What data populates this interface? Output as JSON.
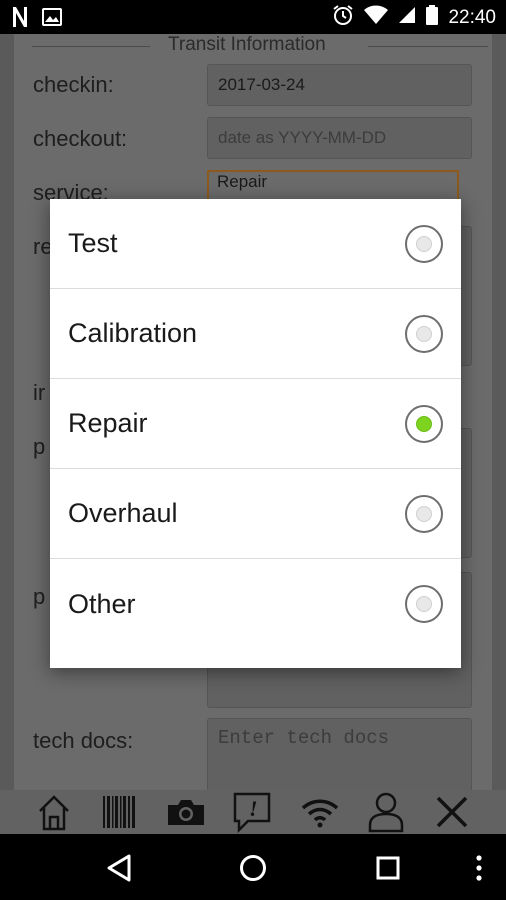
{
  "status_bar": {
    "time": "22:40",
    "icons": [
      "notification-n-icon",
      "image-icon",
      "alarm-icon",
      "wifi-icon",
      "signal-icon",
      "battery-icon"
    ]
  },
  "form": {
    "legend": "Transit Information",
    "checkin_label": "checkin:",
    "checkin_value": "2017-03-24",
    "checkout_label": "checkout:",
    "checkout_placeholder": "date as YYYY-MM-DD",
    "service_label": "service:",
    "service_value": "Repair",
    "partial_labels": [
      "re",
      "ir",
      "p",
      "p"
    ],
    "tech_docs_label": "tech docs:",
    "tech_docs_placeholder": "Enter tech docs"
  },
  "dialog": {
    "options": [
      {
        "label": "Test",
        "selected": false
      },
      {
        "label": "Calibration",
        "selected": false
      },
      {
        "label": "Repair",
        "selected": true
      },
      {
        "label": "Overhaul",
        "selected": false
      },
      {
        "label": "Other",
        "selected": false
      }
    ],
    "accent_color": "#7ed321"
  },
  "toolbar": {
    "icons": [
      "home-icon",
      "barcode-icon",
      "camera-icon",
      "alert-message-icon",
      "wifi-icon",
      "user-icon",
      "close-icon"
    ]
  },
  "navbar": {
    "icons": [
      "back-icon",
      "home-circle-icon",
      "recents-icon",
      "more-icon"
    ]
  }
}
